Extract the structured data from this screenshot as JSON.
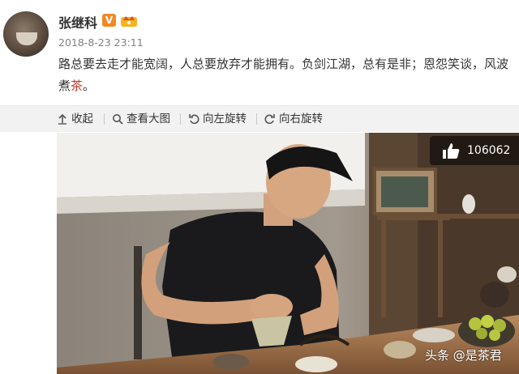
{
  "post": {
    "username": "张继科",
    "verified_badge": "V",
    "timestamp": "2018-8-23 23:11",
    "text_main": "路总要去走才能宽阔，人总要放弃才能拥有。负剑江湖，总有是非；恩怨笑谈，风波煮",
    "text_highlight": "茶",
    "text_end": "。"
  },
  "toolbar": {
    "collapse_label": "收起",
    "view_large_label": "查看大图",
    "rotate_left_label": "向左旋转",
    "rotate_right_label": "向右旋转"
  },
  "photo": {
    "like_count": "106062",
    "watermark": "头条 @是茶君"
  },
  "icons": {
    "collapse": "arrow-up-icon",
    "view_large": "magnifier-icon",
    "rotate_left": "rotate-left-icon",
    "rotate_right": "rotate-right-icon",
    "like": "thumbs-up-icon"
  },
  "colors": {
    "highlight": "#c0392b",
    "verified": "#f08a24",
    "toolbar_bg": "#f2f2f2"
  }
}
